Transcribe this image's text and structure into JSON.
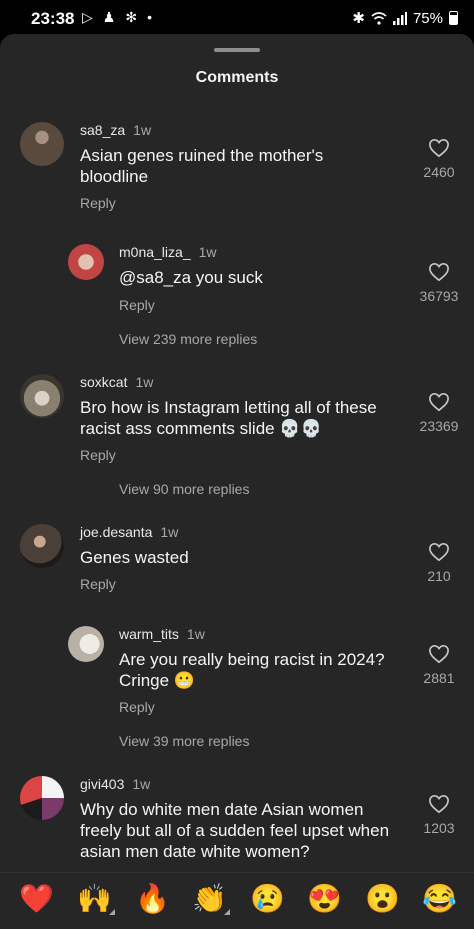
{
  "status": {
    "time": "23:38",
    "left_icons": [
      "play-store-icon",
      "person-icon",
      "fan-icon",
      "dot-icon"
    ],
    "bluetooth": "bluetooth-icon",
    "wifi": "wifi-icon",
    "signal": "signal-icon",
    "battery": "75%"
  },
  "sheet": {
    "title": "Comments"
  },
  "comments": [
    {
      "user": "sa8_za",
      "time": "1w",
      "text_lines": [
        "Asian genes ruined the mother's",
        "bloodline"
      ],
      "reply": "Reply",
      "likes": "2460",
      "avatar_color": "#5a4a3e"
    },
    {
      "user": "m0na_liza_",
      "time": "1w",
      "text_lines": [
        "@sa8_za you suck"
      ],
      "reply": "Reply",
      "likes": "36793",
      "view_more": "View 239 more replies",
      "avatar_color": "#c24545"
    },
    {
      "user": "soxkcat",
      "time": "1w",
      "text_lines": [
        "Bro how is Instagram letting all of these",
        "racist ass comments slide 💀💀"
      ],
      "reply": "Reply",
      "likes": "23369",
      "view_more": "View 90 more replies",
      "avatar_color": "#8a8070"
    },
    {
      "user": "joe.desanta",
      "time": "1w",
      "text_lines": [
        "Genes wasted"
      ],
      "reply": "Reply",
      "likes": "210",
      "avatar_color": "#4b4038"
    },
    {
      "user": "warm_tits",
      "time": "1w",
      "text_lines": [
        "Are you really being racist in 2024?",
        "Cringe 😬"
      ],
      "reply": "Reply",
      "likes": "2881",
      "view_more": "View 39 more replies",
      "avatar_color": "#d9d3cc"
    },
    {
      "user": "givi403",
      "time": "1w",
      "text_lines": [
        "Why do white men date Asian women",
        "freely but all of a sudden feel upset when",
        "asian men date white women?"
      ],
      "likes": "1203",
      "avatar_color": "#7a3a6a"
    }
  ],
  "emoji_bar": [
    "❤️",
    "🙌",
    "🔥",
    "👏",
    "😢",
    "😍",
    "😮",
    "😂"
  ]
}
